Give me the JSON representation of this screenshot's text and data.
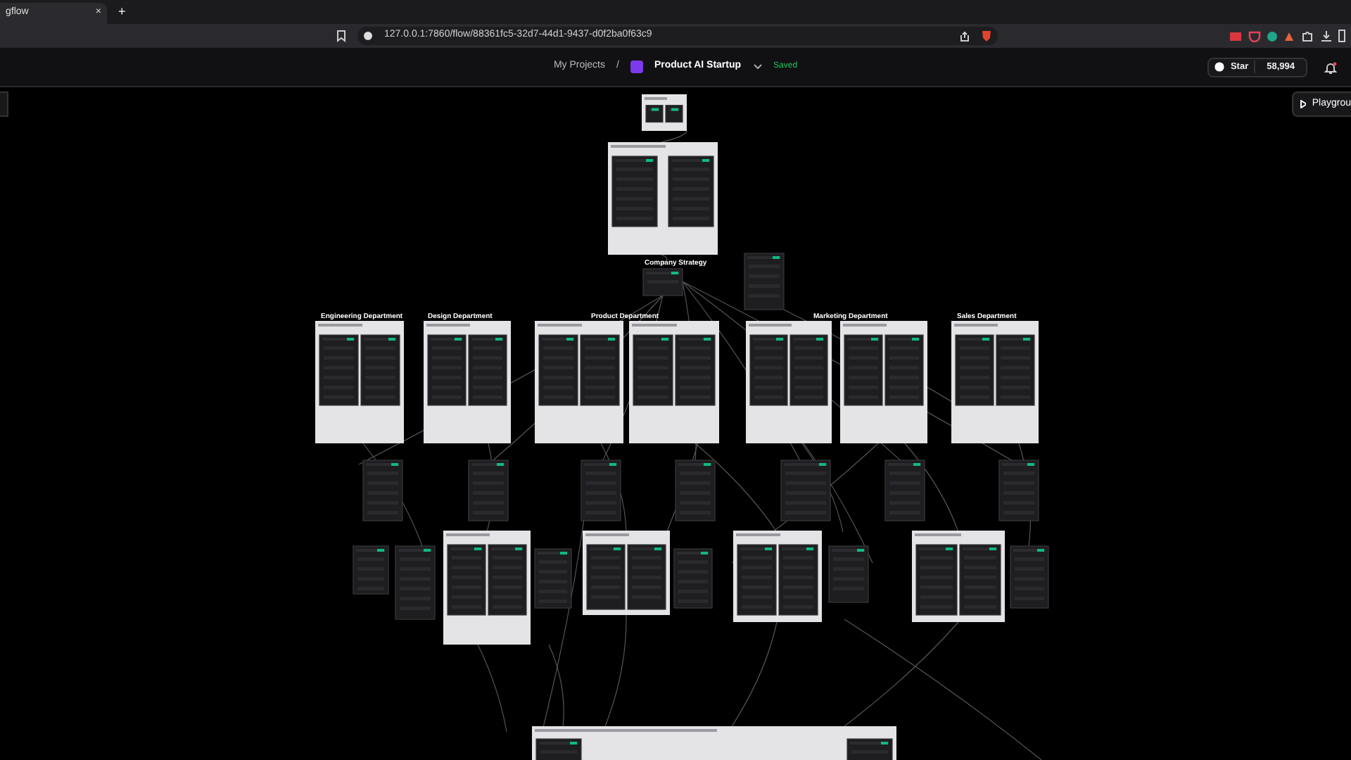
{
  "browser": {
    "tab": {
      "title": "gflow",
      "close": "×"
    },
    "new_tab": "+",
    "url": "127.0.0.1:7860/flow/88361fc5-32d7-44d1-9437-d0f2ba0f63c9"
  },
  "header": {
    "breadcrumb": "My Projects",
    "separator": "/",
    "project": "Product AI Startup",
    "status": "Saved",
    "star": {
      "label": "Star",
      "count": "58,994"
    }
  },
  "canvas": {
    "playground": "Playgrou",
    "strategy_label": "Company Strategy",
    "groups": [
      {
        "label": "Engineering Department"
      },
      {
        "label": "Design Department"
      },
      {
        "label": "Product Department"
      },
      {
        "label": "Marketing Department"
      },
      {
        "label": "Sales Department"
      }
    ]
  }
}
